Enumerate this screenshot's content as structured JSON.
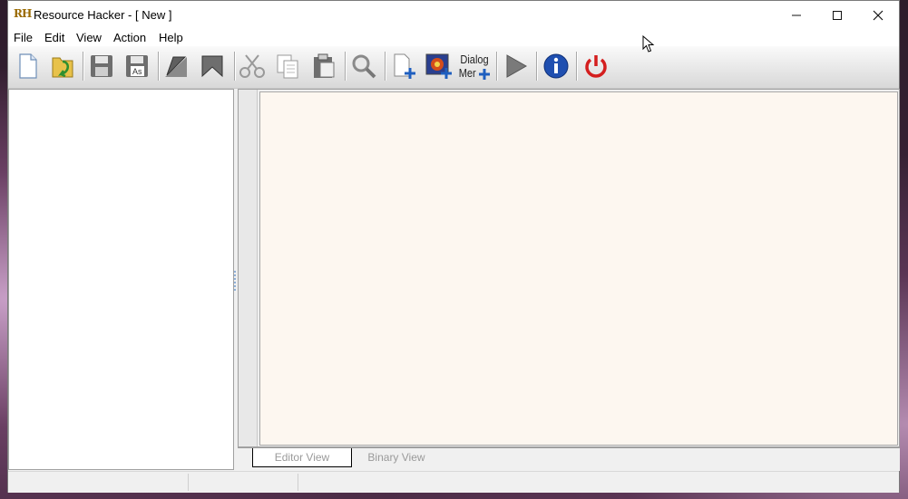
{
  "window": {
    "title": "Resource Hacker - [ New ]",
    "logo": "RH"
  },
  "window_controls": {
    "minimize": "—",
    "maximize": "☐",
    "close": "✕"
  },
  "menu": [
    "File",
    "Edit",
    "View",
    "Action",
    "Help"
  ],
  "toolbar": {
    "buttons": [
      {
        "name": "new-file-icon"
      },
      {
        "name": "open-folder-icon"
      },
      {
        "name": "save-icon"
      },
      {
        "name": "save-as-icon",
        "text": "As"
      },
      {
        "name": "compile-icon"
      },
      {
        "name": "bookmark-icon"
      },
      {
        "name": "cut-icon"
      },
      {
        "name": "copy-icon"
      },
      {
        "name": "paste-icon"
      },
      {
        "name": "search-icon"
      },
      {
        "name": "add-blank-resource-icon"
      },
      {
        "name": "add-image-resource-icon"
      },
      {
        "name": "dialog-menu-icon",
        "line1": "Dialog",
        "line2": "Mer"
      },
      {
        "name": "run-script-icon"
      },
      {
        "name": "info-icon"
      },
      {
        "name": "power-icon"
      }
    ]
  },
  "tabs": {
    "editor_view": "Editor View",
    "binary_view": "Binary View"
  },
  "colors": {
    "accent": "#1f5fbf",
    "power": "#d41e1e",
    "editor_bg": "#fdf7f0"
  }
}
